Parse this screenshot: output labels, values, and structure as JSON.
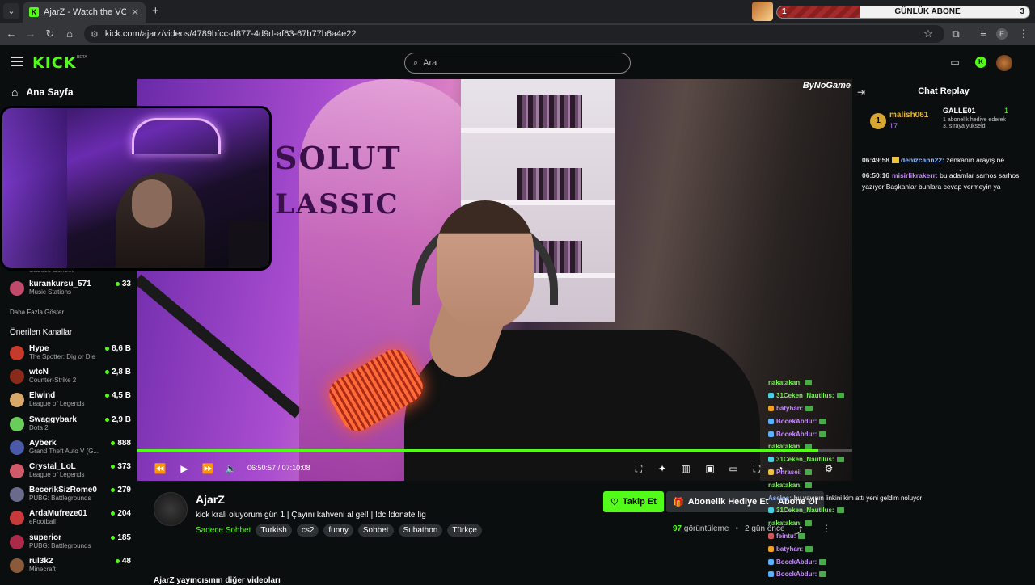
{
  "browser": {
    "tab_title": "AjarZ - Watch the VOD on Kick",
    "url": "kick.com/ajarz/videos/4789bfcc-d877-4d9d-af63-67b77b6a4e22",
    "promo": {
      "left_num": "1",
      "label": "GÜNLÜK ABONE",
      "right_num": "3",
      "progress": 0.33
    }
  },
  "header": {
    "logo": "KICK",
    "beta": "BETA",
    "search_placeholder": "Ara"
  },
  "sidebar": {
    "home_label": "Ana Sayfa",
    "faint_label": "Sadece Sohbet",
    "followed": [
      {
        "name": "kurankursu_571",
        "category": "Music Stations",
        "viewers": "33",
        "color": "#c04a6a"
      }
    ],
    "more_label": "Daha Fazla Göster",
    "recommended_title": "Önerilen Kanallar",
    "recommended": [
      {
        "name": "Hype",
        "category": "The Spotter: Dig or Die",
        "viewers": "8,6 B",
        "color": "#c53a2a"
      },
      {
        "name": "wtcN",
        "category": "Counter-Strike 2",
        "viewers": "2,8 B",
        "color": "#8a2a1a"
      },
      {
        "name": "Elwind",
        "category": "League of Legends",
        "viewers": "4,5 B",
        "color": "#d8a86a"
      },
      {
        "name": "Swaggybark",
        "category": "Dota 2",
        "viewers": "2,9 B",
        "color": "#6acc5a"
      },
      {
        "name": "Ayberk",
        "category": "Grand Theft Auto V (G...",
        "viewers": "888",
        "color": "#4a5aa8"
      },
      {
        "name": "Crystal_LoL",
        "category": "League of Legends",
        "viewers": "373",
        "color": "#d05a6a"
      },
      {
        "name": "BecerikSizRome0",
        "category": "PUBG: Battlegrounds",
        "viewers": "279",
        "color": "#6a6a8a"
      },
      {
        "name": "ArdaMufreze01",
        "category": "eFootball",
        "viewers": "204",
        "color": "#c83a3a"
      },
      {
        "name": "superior",
        "category": "PUBG: Battlegrounds",
        "viewers": "185",
        "color": "#aa2a4a"
      },
      {
        "name": "rul3k2",
        "category": "Minecraft",
        "viewers": "48",
        "color": "#8a5a3a"
      }
    ]
  },
  "video": {
    "watermark": "ByNoGame",
    "current_time": "06:50:57",
    "separator": "/",
    "duration": "07:10:08",
    "progress": 0.953
  },
  "overlay_chat": [
    {
      "user": "nakatakan:",
      "color": "#7cf05a",
      "badge": "",
      "emote": true
    },
    {
      "user": "31Ceken_Nautilus:",
      "color": "#7cf05a",
      "badge": "#4ad0e0",
      "emote": true
    },
    {
      "user": "batyhan:",
      "color": "#c88cff",
      "badge": "#f0a020",
      "emote": true
    },
    {
      "user": "BocekAbdur:",
      "color": "#c88cff",
      "badge": "#5ab0ff",
      "emote": true
    },
    {
      "user": "BocekAbdur:",
      "color": "#c88cff",
      "badge": "#5ab0ff",
      "emote": true
    },
    {
      "user": "nakatakan:",
      "color": "#7cf05a",
      "badge": "",
      "emote": true
    },
    {
      "user": "31Ceken_Nautilus:",
      "color": "#7cf05a",
      "badge": "#4ad0e0",
      "emote": true
    },
    {
      "user": "Phrasei:",
      "color": "#c88cff",
      "badge": "#f0c23a",
      "emote": true
    },
    {
      "user": "nakatakan:",
      "color": "#7cf05a",
      "badge": "",
      "emote": true
    },
    {
      "user": "Aselos:",
      "color": "#9ab4ff",
      "badge": "",
      "emote": false,
      "message": "bu yayının linkini kim attı yeni geldim noluyor"
    },
    {
      "user": "31Ceken_Nautilus:",
      "color": "#7cf05a",
      "badge": "#4ad0e0",
      "emote": true
    },
    {
      "user": "nakatakan:",
      "color": "#7cf05a",
      "badge": "",
      "emote": true
    },
    {
      "user": "feintu:",
      "color": "#c88cff",
      "badge": "#d05a5a",
      "emote": true
    },
    {
      "user": "batyhan:",
      "color": "#c88cff",
      "badge": "#f0a020",
      "emote": true
    },
    {
      "user": "BocekAbdur:",
      "color": "#c88cff",
      "badge": "#5ab0ff",
      "emote": true
    },
    {
      "user": "BocekAbdur:",
      "color": "#c88cff",
      "badge": "#5ab0ff",
      "emote": true
    }
  ],
  "info": {
    "channel": "AjarZ",
    "title": "kick krali oluyorum gün 1 | Çayını kahveni al gel! | !dc !donate !ig",
    "first_tag": "Sadece Sohbet",
    "tags": [
      "Turkish",
      "cs2",
      "funny",
      "Sohbet",
      "Subathon",
      "Türkçe"
    ],
    "follow_label": "Takip Et",
    "gift_label": "Abonelik Hediye Et",
    "subscribe_label": "Abone Ol",
    "views_count": "97",
    "views_label": "görüntüleme",
    "dot": "•",
    "ago": "2 gün önce",
    "other_videos": "AjarZ yayıncısının diğer videoları"
  },
  "chat": {
    "title": "Chat Replay",
    "leader": {
      "rank": "1",
      "name": "malish061",
      "count": "17",
      "gifter_name": "GALLE01",
      "gifter_count": "1",
      "gifter_desc": "1 abonelik hediye ederek 3. sıraya yükseldi"
    },
    "messages": [
      {
        "time": "06:49:58",
        "user": "denizcann22:",
        "text": "zenkanın arayış ne",
        "crown": true,
        "style": "u1"
      },
      {
        "time": "06:50:16",
        "user": "misirlikrakerr:",
        "text": "bu adamlar sarhos sarhos yazıyor Başkanlar bunlara cevap vermeyin ya",
        "crown": false,
        "style": "u2"
      }
    ]
  }
}
